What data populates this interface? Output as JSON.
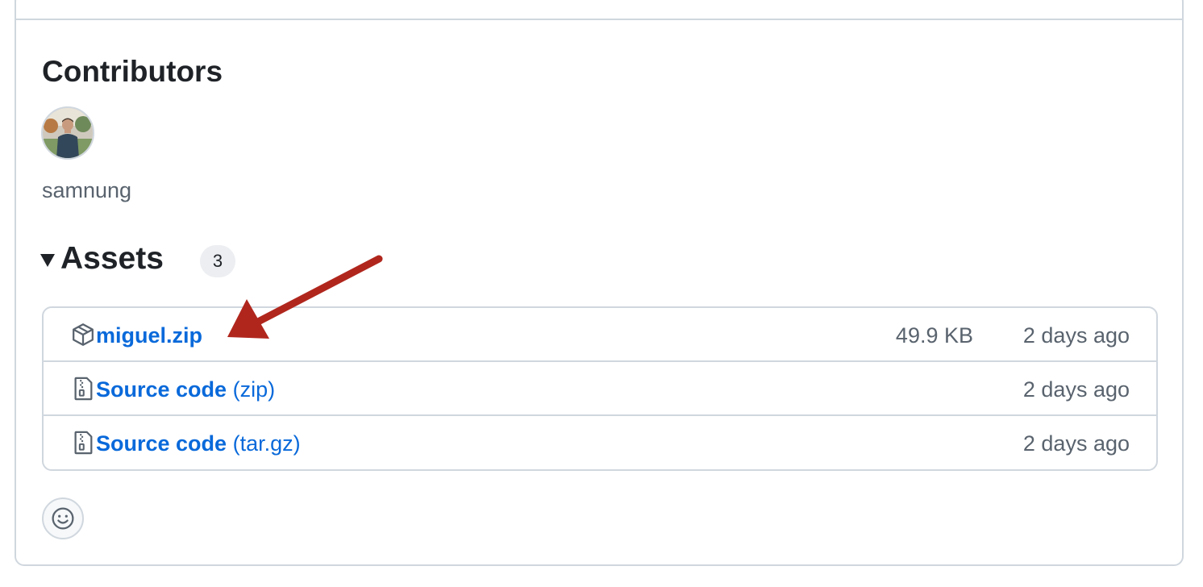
{
  "contributors": {
    "title": "Contributors",
    "users": [
      {
        "name": "samnung"
      }
    ]
  },
  "assets": {
    "title": "Assets",
    "count": "3",
    "items": [
      {
        "name": "miguel.zip",
        "suffix": "",
        "size": "49.9 KB",
        "time": "2 days ago",
        "icon": "package-icon"
      },
      {
        "name": "Source code",
        "suffix": "(zip)",
        "size": "",
        "time": "2 days ago",
        "icon": "file-zip-icon"
      },
      {
        "name": "Source code",
        "suffix": "(tar.gz)",
        "size": "",
        "time": "2 days ago",
        "icon": "file-zip-icon"
      }
    ]
  },
  "reactions": {
    "icon": "smiley-icon"
  },
  "colors": {
    "link": "#0969da",
    "muted": "#59636e",
    "border": "#d0d7de",
    "annotation_arrow": "#b0261d"
  }
}
